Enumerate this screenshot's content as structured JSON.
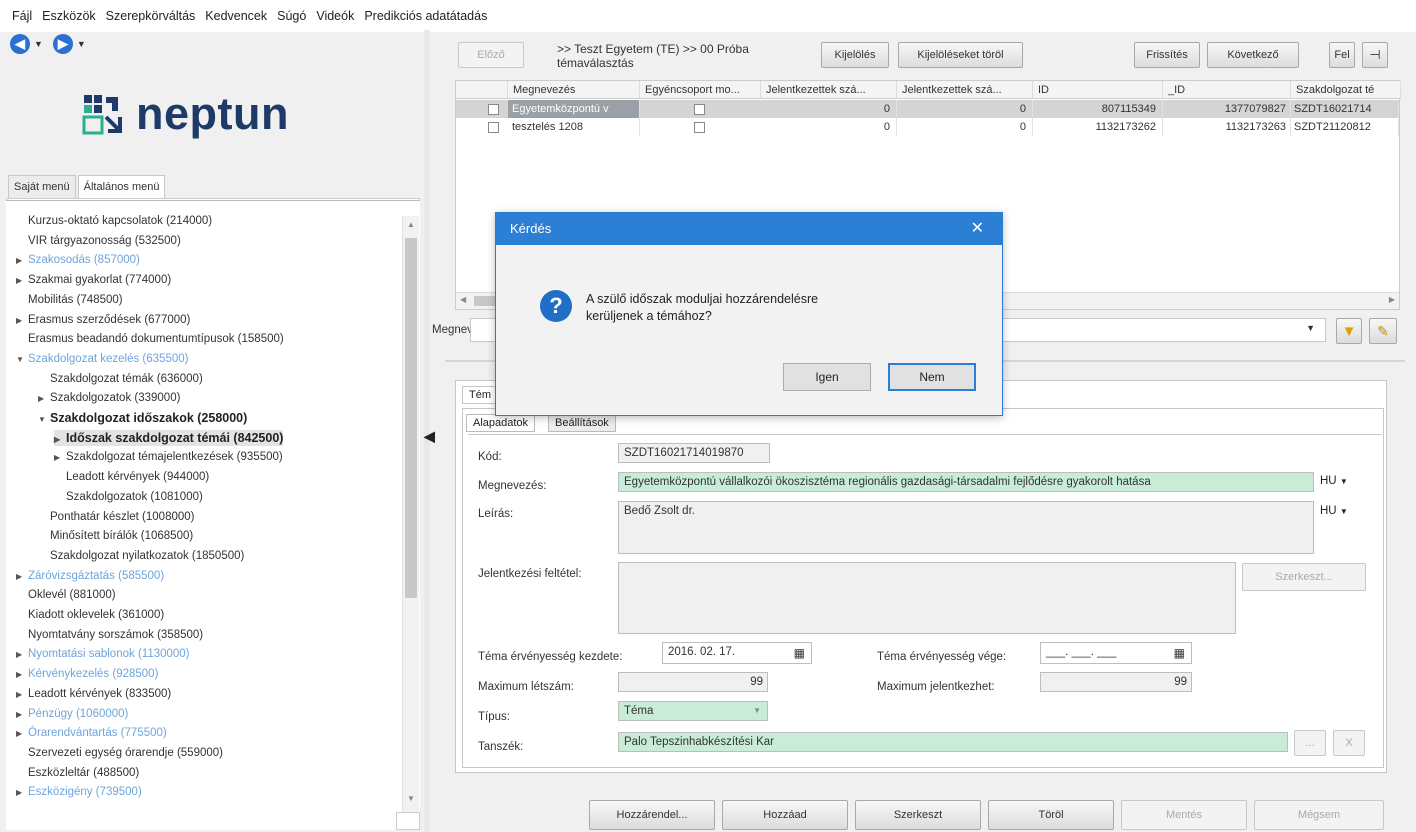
{
  "menu": [
    "Fájl",
    "Eszközök",
    "Szerepkörváltás",
    "Kedvencek",
    "Súgó",
    "Videók",
    "Predikciós adatátadás"
  ],
  "logo_text": "neptun",
  "left_tabs": [
    "Saját menü",
    "Általános menü"
  ],
  "tree": [
    {
      "label": "Kurzus-oktató kapcsolatok (214000)",
      "indent": 0,
      "arrow": "",
      "style": "normal"
    },
    {
      "label": "VIR tárgyazonosság (532500)",
      "indent": 0,
      "arrow": "",
      "style": "normal"
    },
    {
      "label": "Szakosodás (857000)",
      "indent": 0,
      "arrow": "▶",
      "style": "link"
    },
    {
      "label": "Szakmai gyakorlat (774000)",
      "indent": 0,
      "arrow": "▶",
      "style": "normal"
    },
    {
      "label": "Mobilitás (748500)",
      "indent": 0,
      "arrow": "",
      "style": "normal"
    },
    {
      "label": "Erasmus szerződések (677000)",
      "indent": 0,
      "arrow": "▶",
      "style": "normal"
    },
    {
      "label": "Erasmus beadandó dokumentumtípusok (158500)",
      "indent": 0,
      "arrow": "",
      "style": "normal"
    },
    {
      "label": "Szakdolgozat kezelés (635500)",
      "indent": 0,
      "arrow": "▼",
      "style": "link"
    },
    {
      "label": "Szakdolgozat témák (636000)",
      "indent": 1,
      "arrow": "",
      "style": "normal"
    },
    {
      "label": "Szakdolgozatok (339000)",
      "indent": 1,
      "arrow": "▶",
      "style": "normal"
    },
    {
      "label": "Szakdolgozat időszakok (258000)",
      "indent": 1,
      "arrow": "▼",
      "style": "bold"
    },
    {
      "label": "Időszak szakdolgozat témái (842500)",
      "indent": 2,
      "arrow": "▶",
      "style": "bold"
    },
    {
      "label": "Szakdolgozat témajelentkezések (935500)",
      "indent": 2,
      "arrow": "▶",
      "style": "normal"
    },
    {
      "label": "Leadott kérvények (944000)",
      "indent": 2,
      "arrow": "",
      "style": "normal"
    },
    {
      "label": "Szakdolgozatok (1081000)",
      "indent": 2,
      "arrow": "",
      "style": "normal"
    },
    {
      "label": "Ponthatár készlet (1008000)",
      "indent": 1,
      "arrow": "",
      "style": "normal"
    },
    {
      "label": "Minősített bírálók (1068500)",
      "indent": 1,
      "arrow": "",
      "style": "normal"
    },
    {
      "label": "Szakdolgozat nyilatkozatok (1850500)",
      "indent": 1,
      "arrow": "",
      "style": "normal"
    },
    {
      "label": "Záróvizsgáztatás (585500)",
      "indent": 0,
      "arrow": "▶",
      "style": "link"
    },
    {
      "label": "Oklevél (881000)",
      "indent": 0,
      "arrow": "",
      "style": "normal"
    },
    {
      "label": "Kiadott oklevelek (361000)",
      "indent": 0,
      "arrow": "",
      "style": "normal"
    },
    {
      "label": "Nyomtatvány sorszámok (358500)",
      "indent": 0,
      "arrow": "",
      "style": "normal"
    },
    {
      "label": "Nyomtatási sablonok (1130000)",
      "indent": 0,
      "arrow": "▶",
      "style": "link"
    },
    {
      "label": "Kérvénykezelés (928500)",
      "indent": 0,
      "arrow": "▶",
      "style": "link"
    },
    {
      "label": "Leadott kérvények (833500)",
      "indent": 0,
      "arrow": "▶",
      "style": "normal"
    },
    {
      "label": "Pénzügy (1060000)",
      "indent": 0,
      "arrow": "▶",
      "style": "link"
    },
    {
      "label": "Órarendvántartás (775500)",
      "indent": 0,
      "arrow": "▶",
      "style": "link"
    },
    {
      "label": "Szervezeti egység órarendje (559000)",
      "indent": 0,
      "arrow": "",
      "style": "normal"
    },
    {
      "label": "Eszközleltár (488500)",
      "indent": 0,
      "arrow": "",
      "style": "normal"
    },
    {
      "label": "Eszközigény (739500)",
      "indent": 0,
      "arrow": "▶",
      "style": "link"
    }
  ],
  "toolbar": {
    "prev": "Előző",
    "path": ">> Teszt Egyetem (TE) >> 00 Próba témaválasztás",
    "mark": "Kijelölés",
    "unmark": "Kijelöléseket töröl",
    "refresh": "Frissítés",
    "next": "Következő",
    "up": "Fel"
  },
  "grid": {
    "headers": [
      "Megnevezés",
      "Egyéncsoport mo...",
      "Jelentkezettek szá...",
      "Jelentkezettek szá...",
      "ID",
      "_ID",
      "Szakdolgozat té"
    ],
    "rows": [
      {
        "name": "Egyetemközpontú v",
        "j1": "0",
        "j2": "0",
        "id": "807115349",
        "id2": "1377079827",
        "code": "SZDT16021714"
      },
      {
        "name": "tesztelés 1208",
        "j1": "0",
        "j2": "0",
        "id": "1132173262",
        "id2": "1132173263",
        "code": "SZDT21120812"
      }
    ]
  },
  "search_label": "Megnev",
  "form": {
    "outer_tab": "Tém",
    "tabs": [
      "Alapadatok",
      "Beállítások"
    ],
    "kod_label": "Kód:",
    "kod": "SZDT16021714019870",
    "megnevezes_label": "Megnevezés:",
    "megnevezes": "Egyetemközpontú vállalkozói ökoszisztéma regionális gazdasági-társadalmi fejlődésre gyakorolt hatása",
    "lang1": "HU",
    "leiras_label": "Leírás:",
    "leiras": "Bedő Zsolt dr.",
    "lang2": "HU",
    "feltetel_label": "Jelentkezési feltétel:",
    "szerkeszt_small": "Szerkeszt...",
    "kezdete_label": "Téma érvényesség kezdete:",
    "kezdete": "2016. 02. 17.",
    "vege_label": "Téma érvényesség vége:",
    "vege": "___. ___. ___",
    "max_label": "Maximum létszám:",
    "max": "99",
    "maxj_label": "Maximum jelentkezhet:",
    "maxj": "99",
    "tipus_label": "Típus:",
    "tipus": "Téma",
    "tanszek_label": "Tanszék:",
    "tanszek": "Palo Tepszinhabkészítési Kar",
    "x": "X"
  },
  "bottom": [
    "Hozzárendel...",
    "Hozzáad",
    "Szerkeszt",
    "Töröl",
    "Mentés",
    "Mégsem"
  ],
  "dialog": {
    "title": "Kérdés",
    "question": "A szülő időszak moduljai hozzárendelésre kerüljenek a témához?",
    "yes": "Igen",
    "no": "Nem"
  }
}
